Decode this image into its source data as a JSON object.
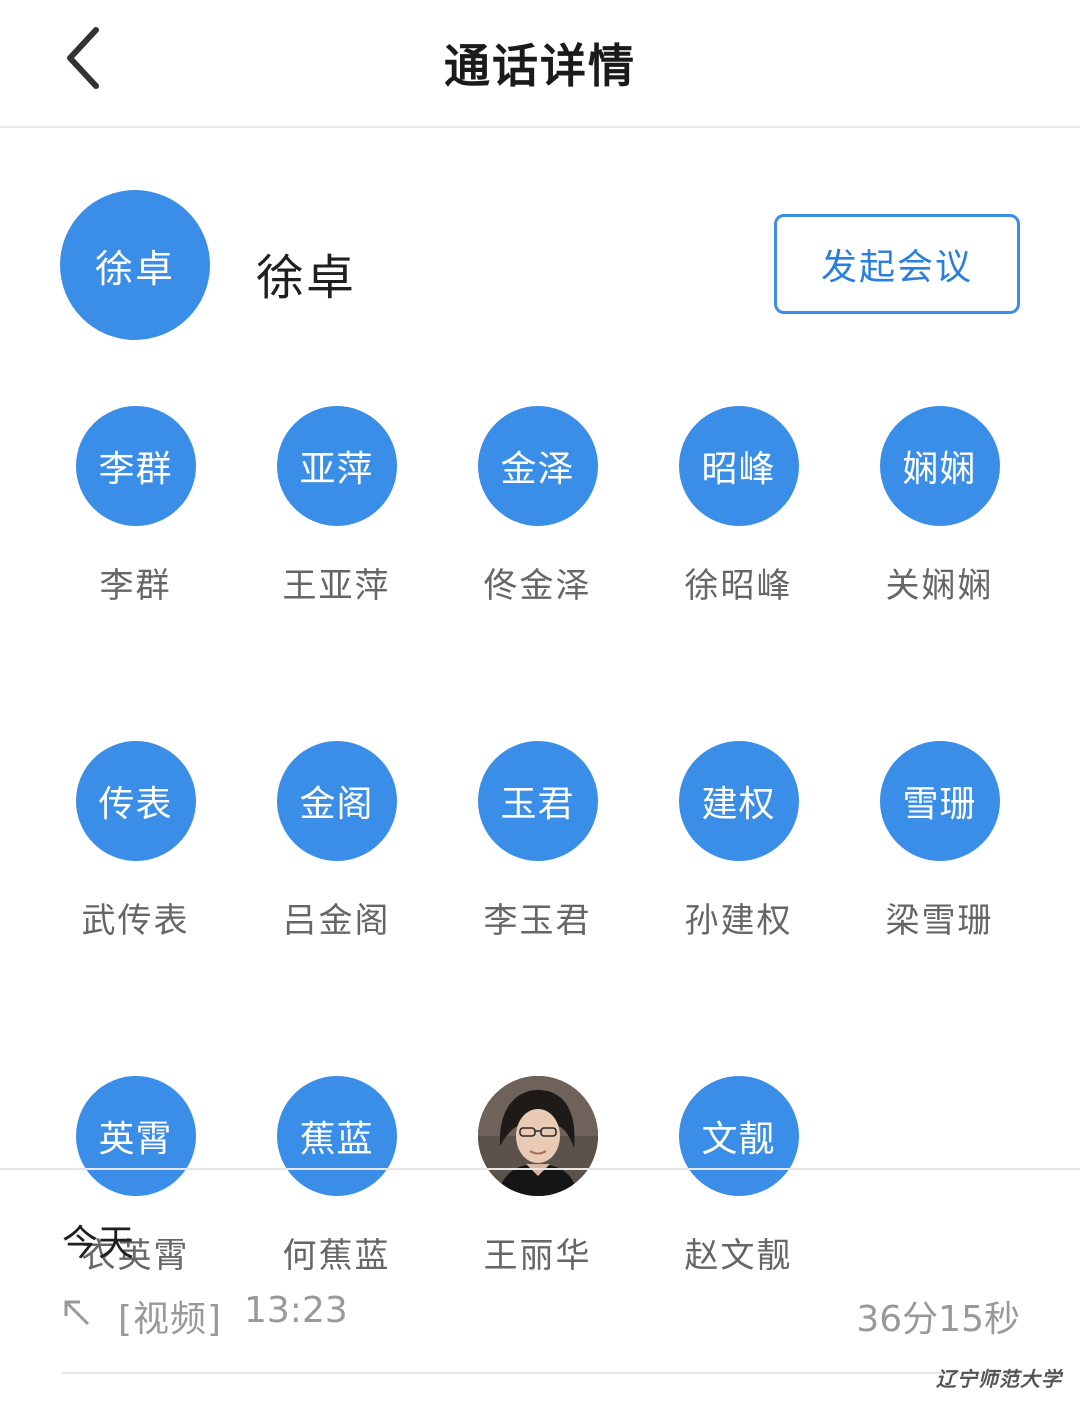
{
  "header": {
    "title": "通话详情",
    "back_icon": "chevron-left-icon"
  },
  "caller": {
    "avatar_text": "徐卓",
    "name": "徐卓",
    "meeting_button": "发起会议"
  },
  "participants": [
    {
      "avatar_text": "李群",
      "name": "李群"
    },
    {
      "avatar_text": "亚萍",
      "name": "王亚萍"
    },
    {
      "avatar_text": "金泽",
      "name": "佟金泽"
    },
    {
      "avatar_text": "昭峰",
      "name": "徐昭峰"
    },
    {
      "avatar_text": "娴娴",
      "name": "关娴娴"
    },
    {
      "avatar_text": "传表",
      "name": "武传表"
    },
    {
      "avatar_text": "金阁",
      "name": "吕金阁"
    },
    {
      "avatar_text": "玉君",
      "name": "李玉君"
    },
    {
      "avatar_text": "建权",
      "name": "孙建权"
    },
    {
      "avatar_text": "雪珊",
      "name": "梁雪珊"
    },
    {
      "avatar_text": "英霄",
      "name": "衣英霄"
    },
    {
      "avatar_text": "蕉蓝",
      "name": "何蕉蓝"
    },
    {
      "avatar_text": "",
      "name": "王丽华",
      "photo": true
    },
    {
      "avatar_text": "文靓",
      "name": "赵文靓"
    }
  ],
  "history": {
    "date_label": "今天",
    "calls": [
      {
        "direction_icon": "outgoing-arrow-icon",
        "type": "[视频]",
        "time": "13:23",
        "duration": "36分15秒"
      }
    ]
  },
  "watermark": "辽宁师范大学",
  "colors": {
    "accent": "#3b8ee7",
    "button_text": "#2a7fdb",
    "secondary_text": "#999999",
    "name_text": "#666666"
  }
}
